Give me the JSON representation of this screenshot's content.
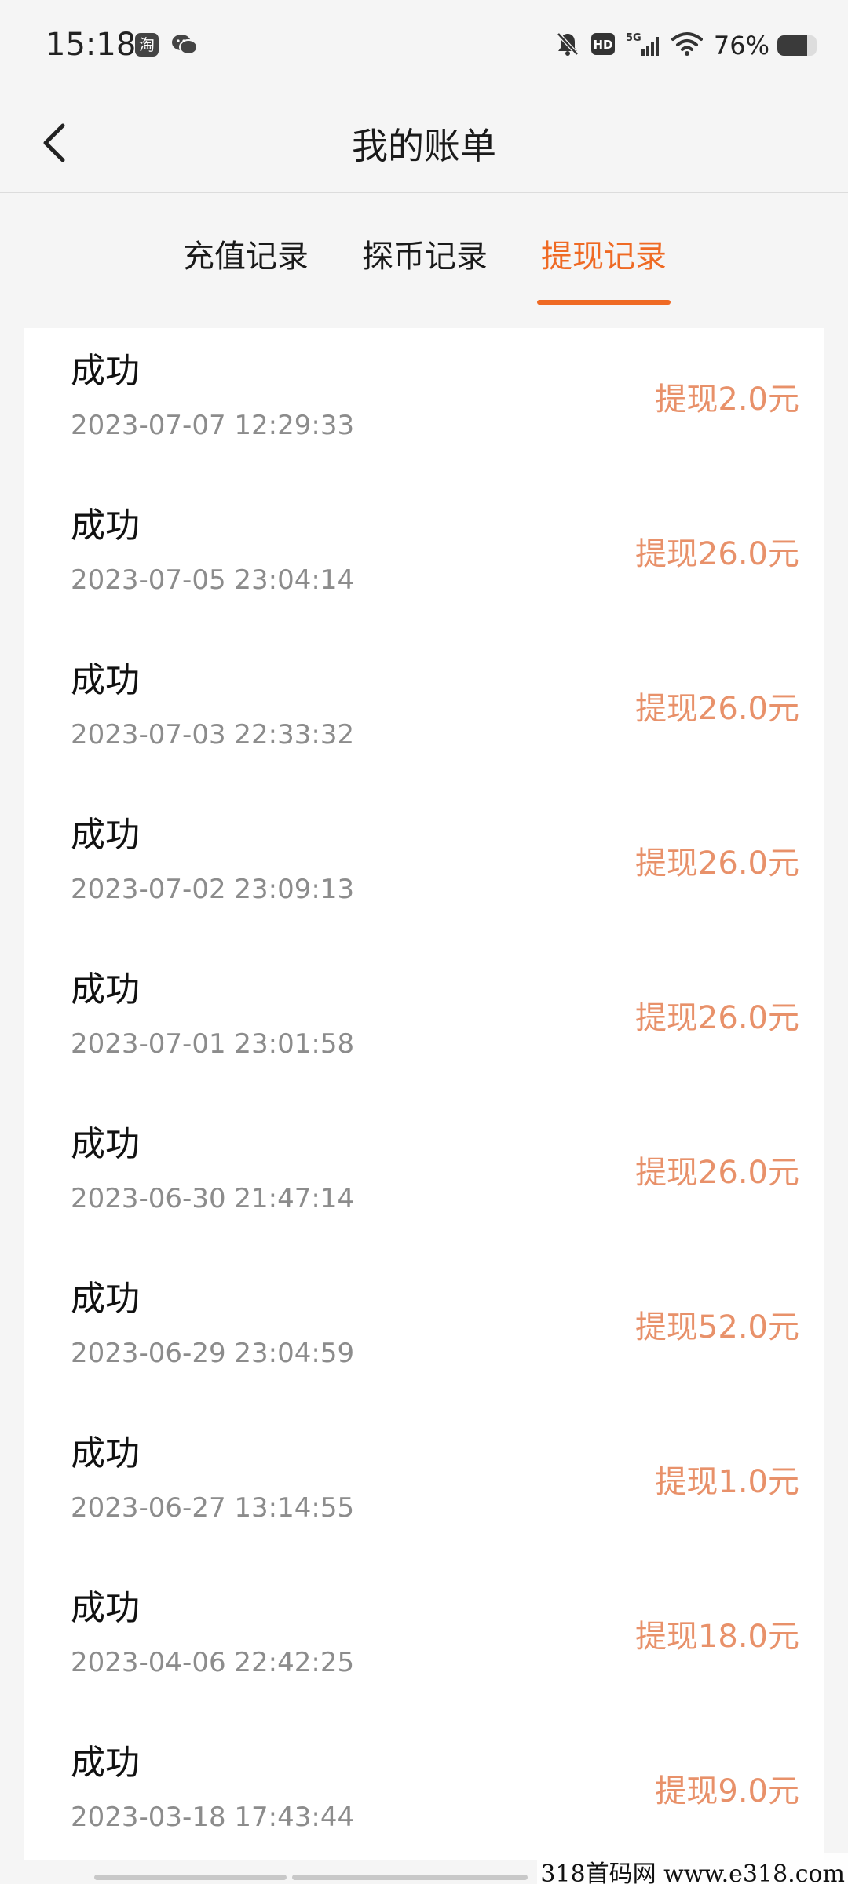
{
  "status_bar": {
    "time": "15:18",
    "taobao_icon_label": "淘",
    "battery_percent": "76%",
    "battery_level": 0.76,
    "network": "5G",
    "hd_label": "HD"
  },
  "header": {
    "title": "我的账单"
  },
  "tabs": [
    {
      "label": "充值记录",
      "active": false
    },
    {
      "label": "探币记录",
      "active": false
    },
    {
      "label": "提现记录",
      "active": true
    }
  ],
  "records": [
    {
      "status": "成功",
      "time": "2023-07-07 12:29:33",
      "amount": "提现2.0元"
    },
    {
      "status": "成功",
      "time": "2023-07-05 23:04:14",
      "amount": "提现26.0元"
    },
    {
      "status": "成功",
      "time": "2023-07-03 22:33:32",
      "amount": "提现26.0元"
    },
    {
      "status": "成功",
      "time": "2023-07-02 23:09:13",
      "amount": "提现26.0元"
    },
    {
      "status": "成功",
      "time": "2023-07-01 23:01:58",
      "amount": "提现26.0元"
    },
    {
      "status": "成功",
      "time": "2023-06-30 21:47:14",
      "amount": "提现26.0元"
    },
    {
      "status": "成功",
      "time": "2023-06-29 23:04:59",
      "amount": "提现52.0元"
    },
    {
      "status": "成功",
      "time": "2023-06-27 13:14:55",
      "amount": "提现1.0元"
    },
    {
      "status": "成功",
      "time": "2023-04-06 22:42:25",
      "amount": "提现18.0元"
    },
    {
      "status": "成功",
      "time": "2023-03-18 17:43:44",
      "amount": "提现9.0元"
    }
  ],
  "watermark": "318首码网  www.e318.com",
  "colors": {
    "accent": "#ef6a24",
    "amount": "#e8916a",
    "secondary_text": "#8c8c8c"
  }
}
